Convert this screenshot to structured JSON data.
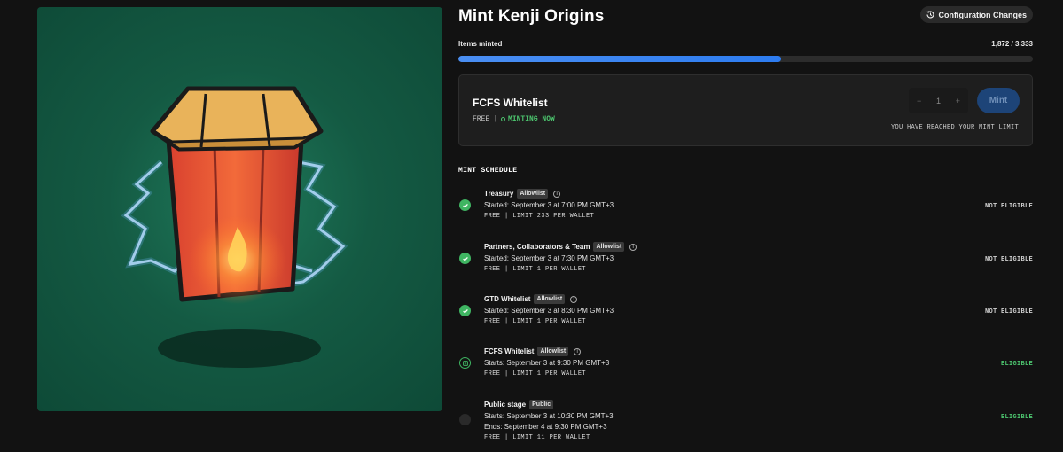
{
  "artwork": {
    "description_icon": "paper-lantern-artwork"
  },
  "collection": {
    "title": "Mint Kenji Origins"
  },
  "config_button": {
    "label": "Configuration Changes",
    "icon": "history-icon"
  },
  "progress": {
    "label": "Items minted",
    "count_text": "1,872 / 3,333",
    "fraction": 0.5617
  },
  "current_stage": {
    "name": "FCFS Whitelist",
    "price": "FREE",
    "separator": "|",
    "status": "MINTING NOW",
    "quantity": "1",
    "decrement": "−",
    "increment": "+",
    "mint_label": "Mint",
    "limit_note": "YOU HAVE REACHED YOUR MINT LIMIT"
  },
  "schedule": {
    "title": "MINT SCHEDULE",
    "items": [
      {
        "name": "Treasury",
        "tag": "Allowlist",
        "line1": "Started: September 3 at 7:00 PM GMT+3",
        "line2": "",
        "terms": "FREE | LIMIT 233 PER WALLET",
        "status": "NOT ELIGIBLE",
        "state": "done"
      },
      {
        "name": "Partners, Collaborators & Team",
        "tag": "Allowlist",
        "line1": "Started: September 3 at 7:30 PM GMT+3",
        "line2": "",
        "terms": "FREE | LIMIT 1 PER WALLET",
        "status": "NOT ELIGIBLE",
        "state": "done"
      },
      {
        "name": "GTD Whitelist",
        "tag": "Allowlist",
        "line1": "Started: September 3 at 8:30 PM GMT+3",
        "line2": "",
        "terms": "FREE | LIMIT 1 PER WALLET",
        "status": "NOT ELIGIBLE",
        "state": "done"
      },
      {
        "name": "FCFS Whitelist",
        "tag": "Allowlist",
        "line1": "Starts: September 3 at 9:30 PM GMT+3",
        "line2": "",
        "terms": "FREE | LIMIT 1 PER WALLET",
        "status": "ELIGIBLE",
        "state": "active"
      },
      {
        "name": "Public stage",
        "tag": "Public",
        "line1": "Starts: September 3 at 10:30 PM GMT+3",
        "line2": "Ends: September 4 at 9:30 PM GMT+3",
        "terms": "FREE | LIMIT 11 PER WALLET",
        "status": "ELIGIBLE",
        "state": "future"
      }
    ]
  },
  "colors": {
    "accent_green": "#4cc46e",
    "progress_blue": "#2d7cf0",
    "mint_button": "#1d4478",
    "background": "#121212"
  }
}
